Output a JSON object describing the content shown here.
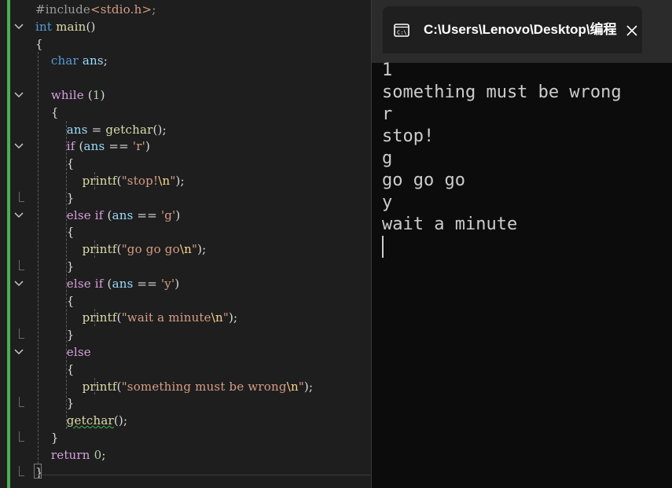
{
  "editor": {
    "lines": [
      {
        "parts": [
          {
            "c": "pre",
            "t": "#include"
          },
          {
            "c": "str",
            "t": "<stdio.h>"
          },
          {
            "c": "pre",
            "t": ";"
          }
        ]
      },
      {
        "parts": [
          {
            "c": "kw",
            "t": "int"
          },
          {
            "c": "",
            "t": " "
          },
          {
            "c": "fn",
            "t": "main"
          },
          {
            "c": "",
            "t": "()"
          }
        ]
      },
      {
        "parts": [
          {
            "c": "",
            "t": "{"
          }
        ]
      },
      {
        "parts": [
          {
            "c": "",
            "t": "    "
          },
          {
            "c": "kw",
            "t": "char"
          },
          {
            "c": "",
            "t": " "
          },
          {
            "c": "var",
            "t": "ans"
          },
          {
            "c": "",
            "t": ";"
          }
        ]
      },
      {
        "parts": []
      },
      {
        "parts": [
          {
            "c": "",
            "t": "    "
          },
          {
            "c": "kw2",
            "t": "while"
          },
          {
            "c": "",
            "t": " ("
          },
          {
            "c": "num",
            "t": "1"
          },
          {
            "c": "",
            "t": ")"
          }
        ]
      },
      {
        "parts": [
          {
            "c": "",
            "t": "    {"
          }
        ]
      },
      {
        "parts": [
          {
            "c": "",
            "t": "        "
          },
          {
            "c": "var",
            "t": "ans"
          },
          {
            "c": "",
            "t": " = "
          },
          {
            "c": "fn",
            "t": "getchar"
          },
          {
            "c": "",
            "t": "();"
          }
        ]
      },
      {
        "parts": [
          {
            "c": "",
            "t": "        "
          },
          {
            "c": "kw2",
            "t": "if"
          },
          {
            "c": "",
            "t": " ("
          },
          {
            "c": "var",
            "t": "ans"
          },
          {
            "c": "",
            "t": " == "
          },
          {
            "c": "str",
            "t": "'r'"
          },
          {
            "c": "",
            "t": ")"
          }
        ]
      },
      {
        "parts": [
          {
            "c": "",
            "t": "        {"
          }
        ]
      },
      {
        "parts": [
          {
            "c": "",
            "t": "            "
          },
          {
            "c": "fn",
            "t": "printf"
          },
          {
            "c": "",
            "t": "("
          },
          {
            "c": "str",
            "t": "\"stop!"
          },
          {
            "c": "esc",
            "t": "\\n"
          },
          {
            "c": "str",
            "t": "\""
          },
          {
            "c": "",
            "t": ");"
          }
        ]
      },
      {
        "parts": [
          {
            "c": "",
            "t": "        }"
          }
        ]
      },
      {
        "parts": [
          {
            "c": "",
            "t": "        "
          },
          {
            "c": "kw2",
            "t": "else"
          },
          {
            "c": "",
            "t": " "
          },
          {
            "c": "kw2",
            "t": "if"
          },
          {
            "c": "",
            "t": " ("
          },
          {
            "c": "var",
            "t": "ans"
          },
          {
            "c": "",
            "t": " == "
          },
          {
            "c": "str",
            "t": "'g'"
          },
          {
            "c": "",
            "t": ")"
          }
        ]
      },
      {
        "parts": [
          {
            "c": "",
            "t": "        {"
          }
        ]
      },
      {
        "parts": [
          {
            "c": "",
            "t": "            "
          },
          {
            "c": "fn",
            "t": "printf"
          },
          {
            "c": "",
            "t": "("
          },
          {
            "c": "str",
            "t": "\"go go go"
          },
          {
            "c": "esc",
            "t": "\\n"
          },
          {
            "c": "str",
            "t": "\""
          },
          {
            "c": "",
            "t": ");"
          }
        ]
      },
      {
        "parts": [
          {
            "c": "",
            "t": "        }"
          }
        ]
      },
      {
        "parts": [
          {
            "c": "",
            "t": "        "
          },
          {
            "c": "kw2",
            "t": "else"
          },
          {
            "c": "",
            "t": " "
          },
          {
            "c": "kw2",
            "t": "if"
          },
          {
            "c": "",
            "t": " ("
          },
          {
            "c": "var",
            "t": "ans"
          },
          {
            "c": "",
            "t": " == "
          },
          {
            "c": "str",
            "t": "'y'"
          },
          {
            "c": "",
            "t": ")"
          }
        ]
      },
      {
        "parts": [
          {
            "c": "",
            "t": "        {"
          }
        ]
      },
      {
        "parts": [
          {
            "c": "",
            "t": "            "
          },
          {
            "c": "fn",
            "t": "printf"
          },
          {
            "c": "",
            "t": "("
          },
          {
            "c": "str",
            "t": "\"wait a minute"
          },
          {
            "c": "esc",
            "t": "\\n"
          },
          {
            "c": "str",
            "t": "\""
          },
          {
            "c": "",
            "t": ");"
          }
        ]
      },
      {
        "parts": [
          {
            "c": "",
            "t": "        }"
          }
        ]
      },
      {
        "parts": [
          {
            "c": "",
            "t": "        "
          },
          {
            "c": "kw2",
            "t": "else"
          }
        ]
      },
      {
        "parts": [
          {
            "c": "",
            "t": "        {"
          }
        ]
      },
      {
        "parts": [
          {
            "c": "",
            "t": "            "
          },
          {
            "c": "fn",
            "t": "printf"
          },
          {
            "c": "",
            "t": "("
          },
          {
            "c": "str",
            "t": "\"something must be wrong"
          },
          {
            "c": "esc",
            "t": "\\n"
          },
          {
            "c": "str",
            "t": "\""
          },
          {
            "c": "",
            "t": ");"
          }
        ]
      },
      {
        "parts": [
          {
            "c": "",
            "t": "        }"
          }
        ]
      },
      {
        "parts": [
          {
            "c": "",
            "t": "        "
          },
          {
            "c": "fn squig",
            "t": "getchar"
          },
          {
            "c": "",
            "t": "();"
          }
        ]
      },
      {
        "parts": [
          {
            "c": "",
            "t": "    }"
          }
        ]
      },
      {
        "parts": [
          {
            "c": "",
            "t": "    "
          },
          {
            "c": "kw2",
            "t": "return"
          },
          {
            "c": "",
            "t": " "
          },
          {
            "c": "num",
            "t": "0"
          },
          {
            "c": "",
            "t": ";"
          }
        ]
      },
      {
        "parts": [
          {
            "c": "",
            "t": "}"
          }
        ]
      }
    ]
  },
  "terminal": {
    "title": "C:\\Users\\Lenovo\\Desktop\\编程",
    "icon": "terminal-icon",
    "close_icon": "close-icon",
    "output": [
      "1",
      "something must be wrong",
      "r",
      "stop!",
      "g",
      "go go go",
      "y",
      "wait a minute"
    ]
  },
  "colors": {
    "keyword": "#569cd6",
    "control": "#d8a0df",
    "variable": "#9cdcfe",
    "function": "#dcdcaa",
    "string": "#d69d85",
    "number": "#b5cea8",
    "change_bar": "#4caf50"
  }
}
